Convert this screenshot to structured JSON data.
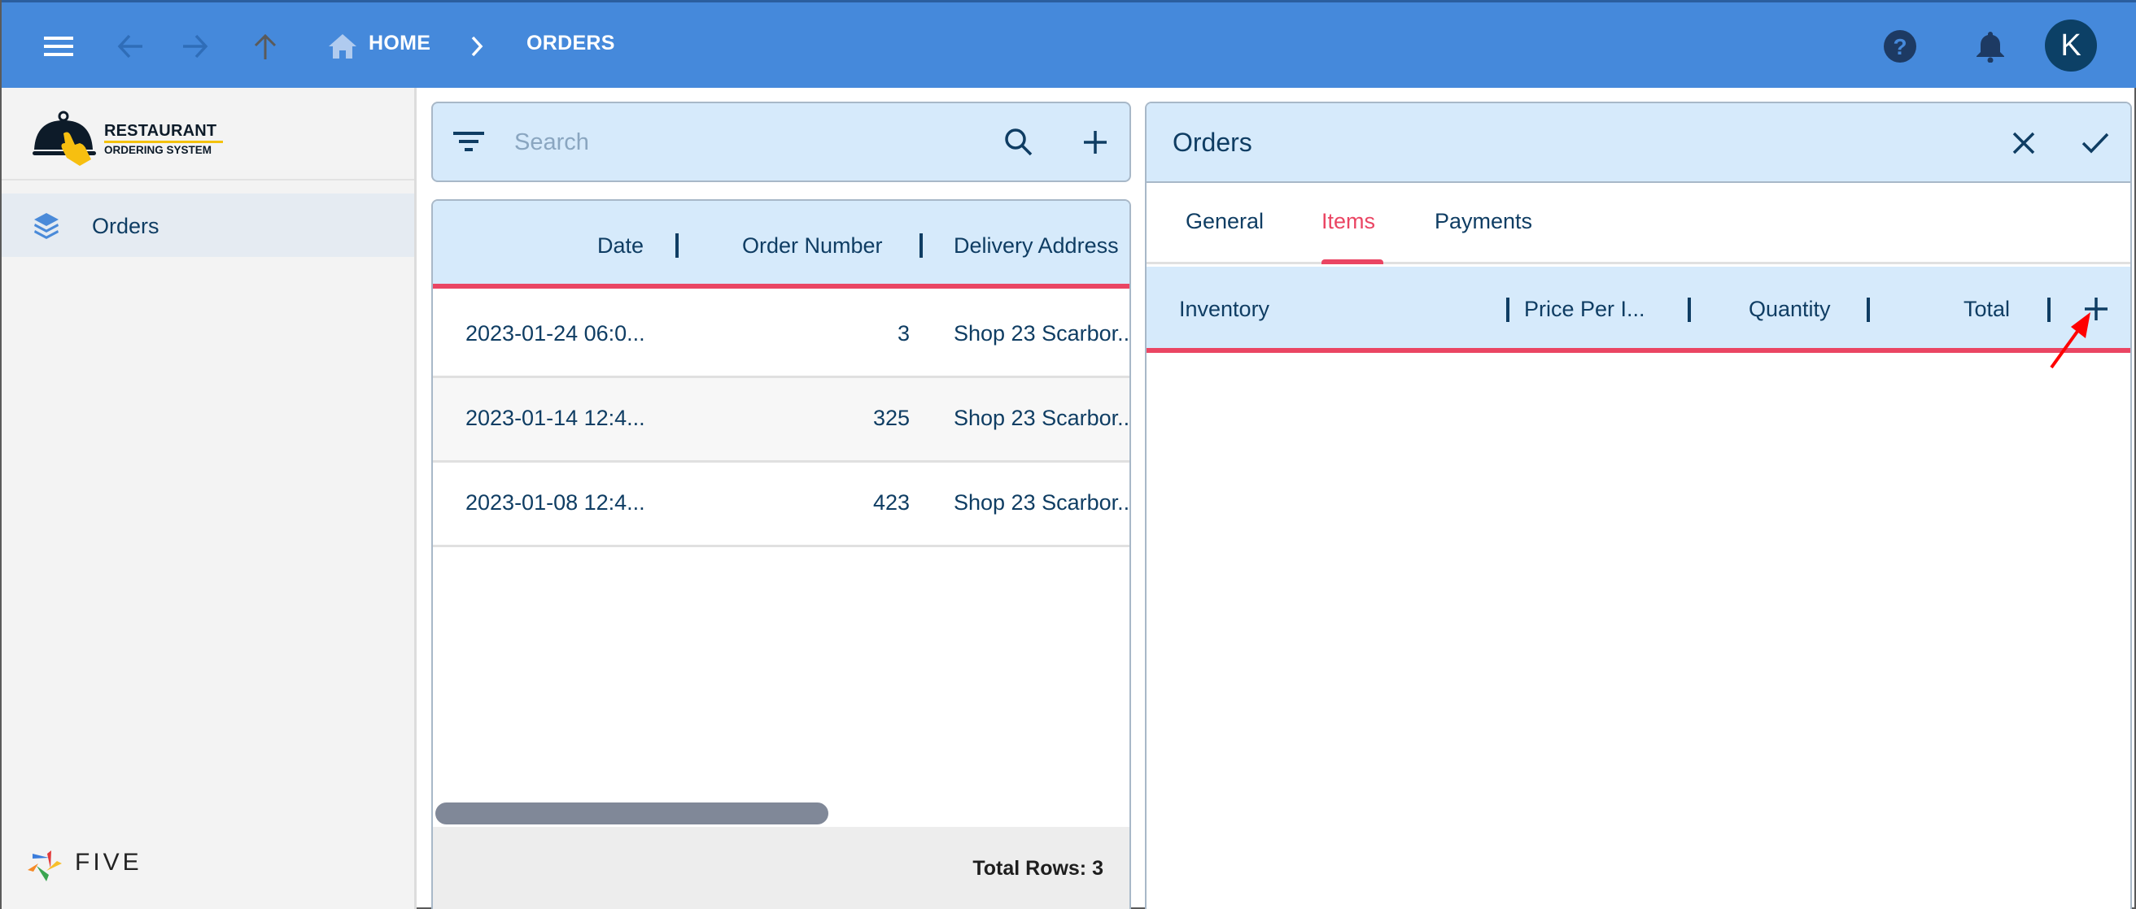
{
  "topbar": {
    "menu_icon": "hamburger-menu-icon",
    "back_icon": "arrow-left-icon",
    "forward_icon": "arrow-right-icon",
    "up_icon": "arrow-up-icon",
    "breadcrumb": {
      "home_icon": "home-icon",
      "home_label": "HOME",
      "separator_icon": "chevron-right-icon",
      "current_label": "ORDERS"
    },
    "help_icon": "help-circle-icon",
    "notifications_icon": "bell-icon",
    "avatar_initial": "K"
  },
  "sidebar": {
    "logo": {
      "line1": "RESTAURANT",
      "line2": "ORDERING SYSTEM"
    },
    "items": [
      {
        "label": "Orders",
        "icon": "layers-icon",
        "selected": true
      }
    ],
    "footer_logo_text": "FIVE"
  },
  "list": {
    "filter_icon": "filter-icon",
    "search": {
      "placeholder": "Search",
      "value": ""
    },
    "search_icon": "search-icon",
    "add_icon": "plus-icon",
    "columns": [
      "Date",
      "Order Number",
      "Delivery Address"
    ],
    "rows": [
      {
        "date": "2023-01-24 06:0...",
        "order_number": "3",
        "delivery_address": "Shop 23 Scarbor..."
      },
      {
        "date": "2023-01-14 12:4...",
        "order_number": "325",
        "delivery_address": "Shop 23 Scarbor..."
      },
      {
        "date": "2023-01-08 12:4...",
        "order_number": "423",
        "delivery_address": "Shop 23 Scarbor..."
      }
    ],
    "total_rows_label": "Total Rows: 3"
  },
  "form": {
    "title": "Orders",
    "cancel_icon": "close-icon",
    "save_icon": "check-icon",
    "tabs": [
      {
        "label": "General",
        "active": false
      },
      {
        "label": "Items",
        "active": true
      },
      {
        "label": "Payments",
        "active": false
      }
    ],
    "items_table": {
      "columns": [
        "Inventory",
        "Price Per I...",
        "Quantity",
        "Total"
      ],
      "add_icon": "plus-icon",
      "rows": []
    }
  },
  "colors": {
    "topbar": "#4589db",
    "accent": "#ea4563",
    "header_bg": "#d6eafb",
    "text": "#0f3d63",
    "annotation_arrow": "#ff0000"
  }
}
